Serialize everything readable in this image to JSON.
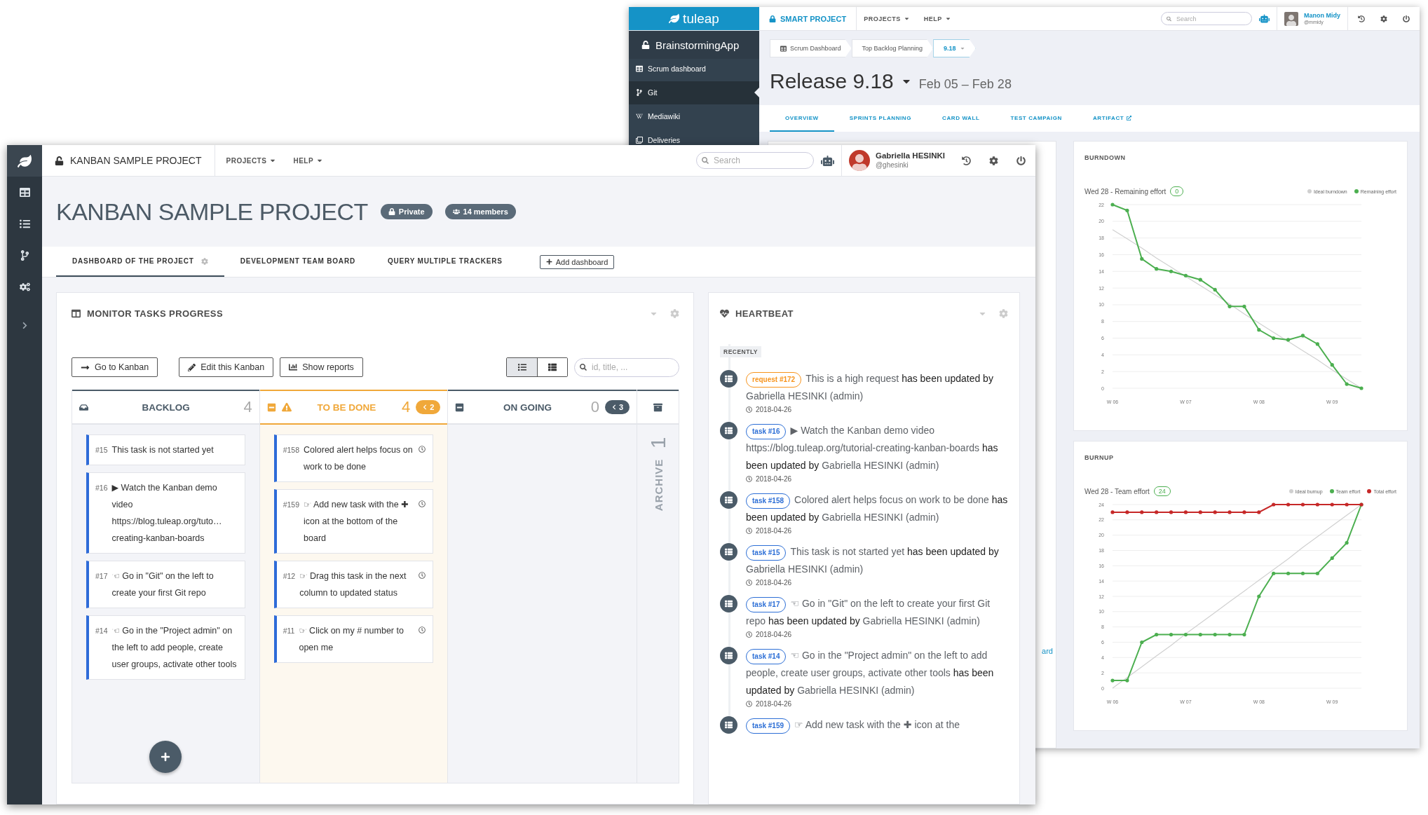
{
  "back_window": {
    "logo": "tuleap",
    "project": "SMART PROJECT",
    "nav": [
      "PROJECTS",
      "HELP"
    ],
    "search": {
      "placeholder": "Search"
    },
    "user": {
      "name": "Manon Midy",
      "handle": "@mmidy"
    },
    "sidebar": {
      "project": "BrainstormingApp",
      "items": [
        {
          "label": "Scrum dashboard",
          "selected": false
        },
        {
          "label": "Git",
          "selected": true
        },
        {
          "label": "Mediawiki",
          "selected": false
        },
        {
          "label": "Deliveries",
          "selected": false
        }
      ]
    },
    "breadcrumb": [
      {
        "label": "Scrum Dashboard",
        "selected": false
      },
      {
        "label": "Top Backlog Planning",
        "selected": false
      },
      {
        "label": "9.18",
        "selected": true
      }
    ],
    "release": {
      "title": "Release 9.18",
      "dates": "Feb 05 – Feb 28"
    },
    "tabs": [
      {
        "label": "OVERVIEW",
        "selected": true,
        "external": false
      },
      {
        "label": "SPRINTS PLANNING",
        "selected": false,
        "external": false
      },
      {
        "label": "CARD WALL",
        "selected": false,
        "external": false
      },
      {
        "label": "TEST CAMPAIGN",
        "selected": false,
        "external": false
      },
      {
        "label": "ARTIFACT",
        "selected": false,
        "external": true
      }
    ],
    "left_card_text": "ard",
    "burndown": {
      "title": "BURNDOWN",
      "summary": "Wed 28 - Remaining effort",
      "count": "0",
      "chart_data": {
        "type": "line",
        "grid": true,
        "categories": [
          "W 06",
          null,
          null,
          null,
          null,
          "W 07",
          null,
          null,
          null,
          null,
          "W 08",
          null,
          null,
          null,
          null,
          "W 09",
          null,
          null
        ],
        "ylim": [
          0,
          22
        ],
        "yticks": [
          0,
          2,
          4,
          6,
          8,
          10,
          12,
          14,
          16,
          18,
          20,
          22
        ],
        "series": [
          {
            "name": "Ideal burndown",
            "color": "#d0d0d0",
            "values": [
              19,
              17.9,
              16.8,
              15.6,
              14.5,
              13.4,
              12.3,
              11.2,
              10.1,
              8.9,
              7.8,
              6.7,
              5.6,
              4.5,
              3.4,
              2.2,
              1.1,
              0
            ]
          },
          {
            "name": "Remaining effort",
            "color": "#4caf50",
            "values": [
              22,
              21.3,
              15.5,
              14.3,
              14,
              13.5,
              13,
              11.8,
              9.8,
              9.8,
              7,
              6,
              5.8,
              6.3,
              5.3,
              2.8,
              0.5,
              0
            ]
          }
        ]
      }
    },
    "burnup": {
      "title": "BURNUP",
      "summary": "Wed 28 - Team effort",
      "count": "24",
      "chart_data": {
        "type": "line",
        "grid": true,
        "categories": [
          "W 06",
          null,
          null,
          null,
          null,
          "W 07",
          null,
          null,
          null,
          null,
          "W 08",
          null,
          null,
          null,
          null,
          "W 09",
          null,
          null
        ],
        "ylim": [
          0,
          24
        ],
        "yticks": [
          0,
          2,
          4,
          6,
          8,
          10,
          12,
          14,
          16,
          18,
          20,
          22,
          24
        ],
        "series": [
          {
            "name": "Ideal burnup",
            "color": "#d0d0d0",
            "values": [
              0,
              1.4,
              2.8,
              4.2,
              5.6,
              7.1,
              8.5,
              9.9,
              11.3,
              12.7,
              14.1,
              15.5,
              16.9,
              18.4,
              19.8,
              21.2,
              22.6,
              24
            ]
          },
          {
            "name": "Team effort",
            "color": "#4caf50",
            "values": [
              1,
              1,
              6,
              7,
              7,
              7,
              7,
              7,
              7,
              7,
              12,
              15,
              15,
              15,
              15,
              17,
              19,
              24
            ]
          },
          {
            "name": "Total effort",
            "color": "#c62828",
            "values": [
              23,
              23,
              23,
              23,
              23,
              23,
              23,
              23,
              23,
              23,
              23,
              24,
              24,
              24,
              24,
              24,
              24,
              24
            ]
          }
        ]
      }
    }
  },
  "front_window": {
    "project": "KANBAN SAMPLE PROJECT",
    "nav": [
      "PROJECTS",
      "HELP"
    ],
    "search": {
      "placeholder": "Search"
    },
    "user": {
      "name": "Gabriella HESINKI",
      "handle": "@ghesinki"
    },
    "header": {
      "title": "KANBAN SAMPLE PROJECT",
      "badges": [
        "Private",
        "14 members"
      ]
    },
    "tabs": [
      {
        "label": "DASHBOARD OF THE PROJECT",
        "selected": true
      },
      {
        "label": "DEVELOPMENT TEAM BOARD",
        "selected": false
      },
      {
        "label": "QUERY MULTIPLE TRACKERS",
        "selected": false
      }
    ],
    "add_dashboard": "Add dashboard",
    "kanban": {
      "title": "MONITOR TASKS PROGRESS",
      "buttons": [
        "Go to Kanban",
        "Edit this Kanban",
        "Show reports"
      ],
      "views": [
        {
          "selected": true
        },
        {
          "selected": false
        }
      ],
      "search": {
        "placeholder": "id, title, ..."
      },
      "columns": [
        {
          "title": "BACKLOG",
          "count": "4",
          "alert": false,
          "collapsible": false,
          "cards": [
            {
              "id": "#15",
              "text": "This task is not started yet",
              "timer": false
            },
            {
              "id": "#16",
              "text": "▶ Watch the Kanban demo video https://blog.tuleap.org/tuto… creating-kanban-boards",
              "timer": false
            },
            {
              "id": "#17",
              "text": "☜ Go in \"Git\" on the left to create your first Git repo",
              "timer": false
            },
            {
              "id": "#14",
              "text": "☜ Go in the \"Project admin\" on the left to add people, create user groups, activate other tools",
              "timer": false
            }
          ]
        },
        {
          "title": "TO BE DONE",
          "count": "4",
          "alert": true,
          "collapsible": true,
          "limit": "2",
          "cards": [
            {
              "id": "#158",
              "text": "Colored alert helps focus on work to be done",
              "timer": true
            },
            {
              "id": "#159",
              "text": "☞ Add new task with the ✚ icon at the bottom of the board",
              "timer": true
            },
            {
              "id": "#12",
              "text": "☞ Drag this task in the next column to updated status",
              "timer": true
            },
            {
              "id": "#11",
              "text": "☞ Click on my # number to open me",
              "timer": true
            }
          ]
        },
        {
          "title": "ON GOING",
          "count": "0",
          "alert": false,
          "collapsible": true,
          "limit": "3"
        }
      ],
      "archive": {
        "label": "ARCHIVE",
        "count": "1"
      }
    },
    "heartbeat": {
      "title": "HEARTBEAT",
      "section": "RECENTLY",
      "items": [
        {
          "kind": "request",
          "badge": "request #172",
          "title": "This is a high request",
          "action": "has been updated by",
          "author": "Gabriella HESINKI (admin)",
          "date": "2018-04-26"
        },
        {
          "kind": "task",
          "badge": "task #16",
          "title": "▶ Watch the Kanban demo video https://blog.tuleap.org/tutorial-creating-kanban-boards",
          "action": "has been updated by",
          "author": "Gabriella HESINKI (admin)",
          "date": "2018-04-26"
        },
        {
          "kind": "task",
          "badge": "task #158",
          "title": "Colored alert helps focus on work to be done",
          "action": "has been updated by",
          "author": "Gabriella HESINKI (admin)",
          "date": "2018-04-26"
        },
        {
          "kind": "task",
          "badge": "task #15",
          "title": "This task is not started yet",
          "action": "has been updated by",
          "author": "Gabriella HESINKI (admin)",
          "date": "2018-04-26"
        },
        {
          "kind": "task",
          "badge": "task #17",
          "title": "☜ Go in \"Git\" on the left to create your first Git repo",
          "action": "has been updated by",
          "author": "Gabriella HESINKI (admin)",
          "date": "2018-04-26"
        },
        {
          "kind": "task",
          "badge": "task #14",
          "title": "☜ Go in the \"Project admin\" on the left to add people, create user groups, activate other tools",
          "action": "has been updated by",
          "author": "Gabriella HESINKI (admin)",
          "date": "2018-04-26"
        },
        {
          "kind": "task",
          "badge": "task #159",
          "title": "☞ Add new task with the ✚ icon at the"
        }
      ]
    }
  }
}
